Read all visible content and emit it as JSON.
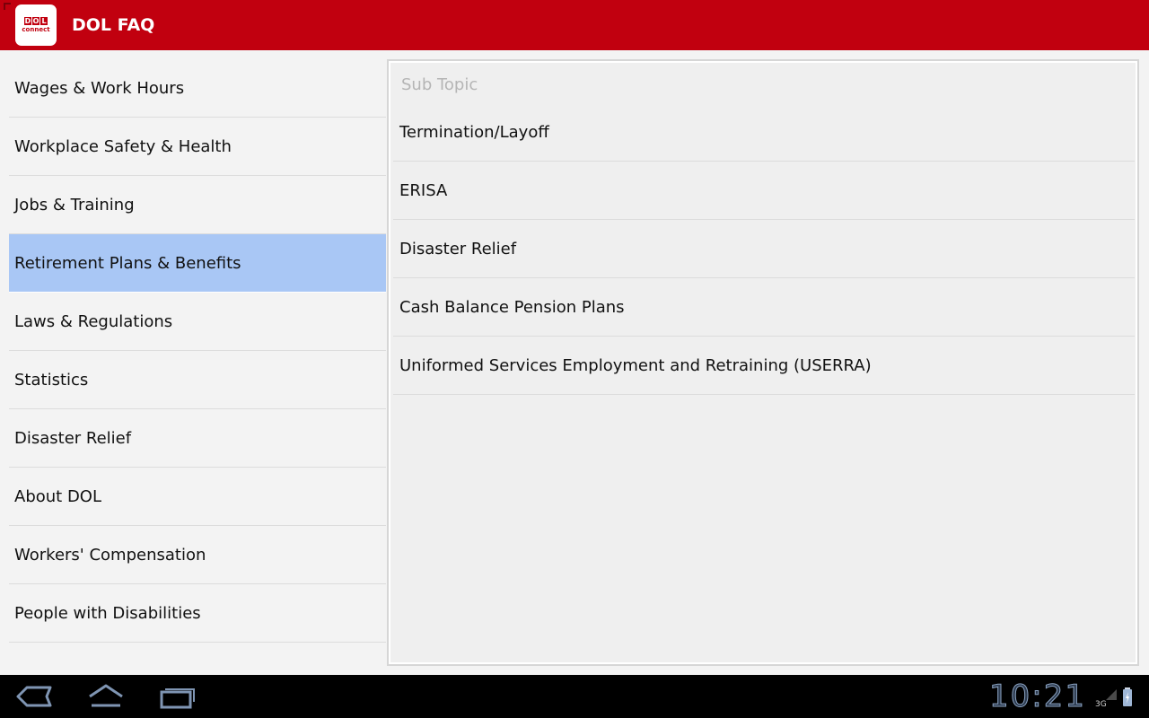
{
  "app_bar": {
    "title": "DOL FAQ",
    "logo_text": "DOL",
    "logo_sub": "connect"
  },
  "topics": [
    {
      "label": "Wages & Work Hours",
      "selected": false
    },
    {
      "label": "Workplace Safety & Health",
      "selected": false
    },
    {
      "label": "Jobs & Training",
      "selected": false
    },
    {
      "label": "Retirement Plans & Benefits",
      "selected": true
    },
    {
      "label": "Laws & Regulations",
      "selected": false
    },
    {
      "label": "Statistics",
      "selected": false
    },
    {
      "label": "Disaster Relief",
      "selected": false
    },
    {
      "label": "About DOL",
      "selected": false
    },
    {
      "label": "Workers' Compensation",
      "selected": false
    },
    {
      "label": "People with Disabilities",
      "selected": false
    }
  ],
  "subtopic_panel": {
    "header": "Sub Topic",
    "items": [
      "Termination/Layoff",
      "ERISA",
      "Disaster Relief",
      "Cash Balance Pension Plans",
      "Uniformed Services Employment and Retraining (USERRA)"
    ]
  },
  "system_bar": {
    "time": "10:21",
    "network": "3G",
    "icons": [
      "back-icon",
      "home-icon",
      "recent-apps-icon",
      "signal-icon",
      "battery-icon"
    ]
  },
  "colors": {
    "action_bar": "#c1000f",
    "selected_item": "#a9c7f5",
    "background": "#f3f3f3",
    "panel": "#efefef"
  }
}
